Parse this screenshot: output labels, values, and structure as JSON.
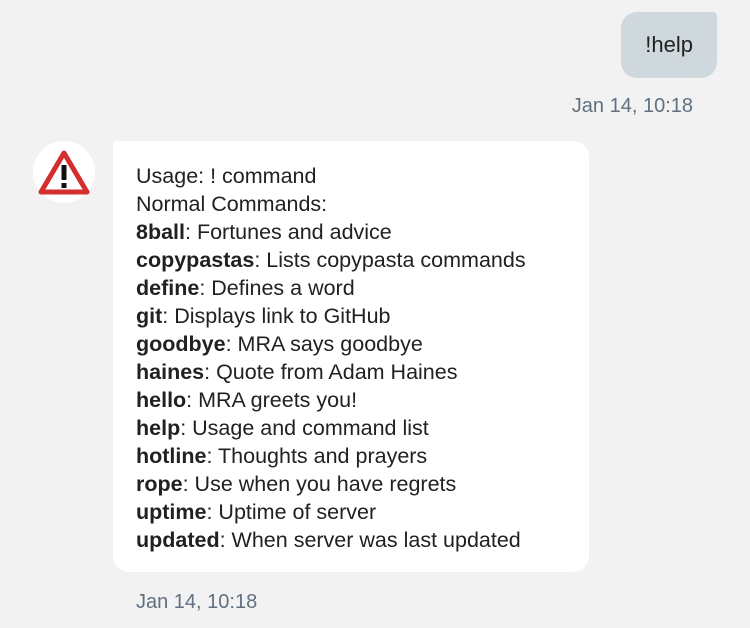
{
  "outgoing": {
    "text": "!help",
    "timestamp": "Jan 14, 10:18"
  },
  "incoming": {
    "avatar_icon": "warning-triangle-icon",
    "usage": "Usage: ! command",
    "section_title": "Normal Commands:",
    "commands": [
      {
        "name": "8ball",
        "desc": ": Fortunes and advice"
      },
      {
        "name": "copypastas",
        "desc": ": Lists copypasta commands"
      },
      {
        "name": "define",
        "desc": ": Defines a word"
      },
      {
        "name": "git",
        "desc": ": Displays link to GitHub"
      },
      {
        "name": "goodbye",
        "desc": ": MRA says goodbye"
      },
      {
        "name": "haines",
        "desc": ": Quote from Adam Haines"
      },
      {
        "name": "hello",
        "desc": ": MRA greets you!"
      },
      {
        "name": "help",
        "desc": ": Usage and command list"
      },
      {
        "name": "hotline",
        "desc": ": Thoughts and prayers"
      },
      {
        "name": "rope",
        "desc": ": Use when you have regrets"
      },
      {
        "name": "uptime",
        "desc": ": Uptime of server"
      },
      {
        "name": "updated",
        "desc": ": When server was last updated"
      }
    ],
    "timestamp": "Jan 14, 10:18"
  },
  "colors": {
    "background": "#f2f2f2",
    "outgoing_bubble": "#cfd8dc",
    "incoming_bubble": "#ffffff",
    "warning_red": "#d32f2f"
  }
}
